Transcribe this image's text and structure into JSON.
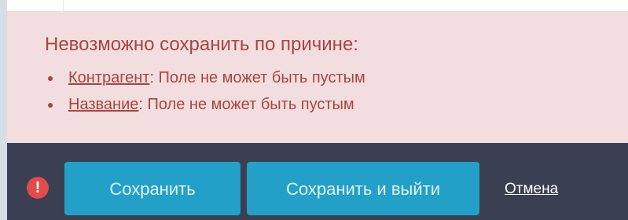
{
  "alert": {
    "title": "Невозможно сохранить по причине:",
    "errors": [
      {
        "field": "Контрагент",
        "message": ": Поле не может быть пустым"
      },
      {
        "field": "Название",
        "message": ": Поле не может быть пустым"
      }
    ]
  },
  "footer": {
    "error_icon_glyph": "!",
    "save_label": "Сохранить",
    "save_exit_label": "Сохранить и выйти",
    "cancel_label": "Отмена"
  },
  "colors": {
    "alert_background": "#f2dede",
    "alert_text": "#a94442",
    "footer_background": "#3a3f51",
    "primary_button": "#23a0c7",
    "error_icon": "#e34a4a"
  },
  "icons": {
    "error": "exclamation-circle-icon"
  }
}
